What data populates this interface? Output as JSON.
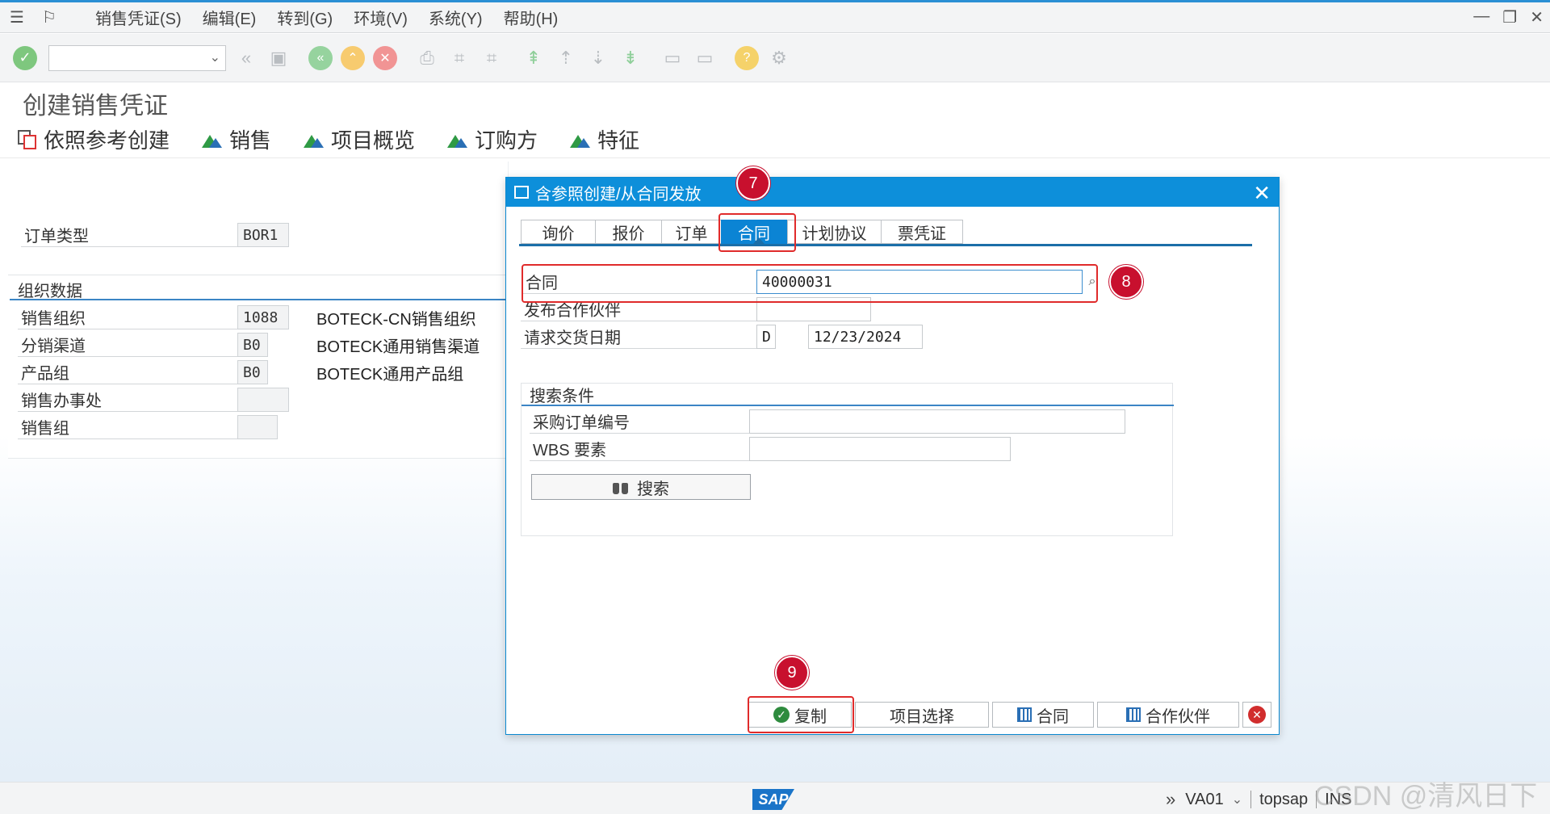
{
  "menubar": {
    "items": [
      "销售凭证(S)",
      "编辑(E)",
      "转到(G)",
      "环境(V)",
      "系统(Y)",
      "帮助(H)"
    ]
  },
  "toolbar": {
    "command_value": "",
    "icons": [
      "ok-icon",
      "back-icon",
      "save-icon",
      "nav-back-icon",
      "exit-icon",
      "cancel-icon",
      "print-icon",
      "find-icon",
      "find-next-icon",
      "first-page-icon",
      "prev-page-icon",
      "next-page-icon",
      "last-page-icon",
      "new-session-icon",
      "shortcut-icon",
      "help-icon",
      "settings-icon"
    ]
  },
  "page": {
    "title": "创建销售凭证"
  },
  "app_toolbar": {
    "ref_create": "依照参考创建",
    "sales": "销售",
    "item_overview": "项目概览",
    "sold_to": "订购方",
    "characteristics": "特征"
  },
  "header": {
    "order_type_label": "订单类型",
    "order_type_value": "BOR1"
  },
  "org": {
    "title": "组织数据",
    "rows": [
      {
        "label": "销售组织",
        "value": "1088",
        "desc": "BOTECK-CN销售组织"
      },
      {
        "label": "分销渠道",
        "value": "B0",
        "desc": "BOTECK通用销售渠道"
      },
      {
        "label": "产品组",
        "value": "B0",
        "desc": "BOTECK通用产品组"
      },
      {
        "label": "销售办事处",
        "value": "",
        "desc": ""
      },
      {
        "label": "销售组",
        "value": "",
        "desc": ""
      }
    ]
  },
  "dialog": {
    "title": "含参照创建/从合同发放",
    "tabs": [
      "询价",
      "报价",
      "订单",
      "合同",
      "计划协议",
      "票凭证"
    ],
    "active_tab": "合同",
    "contract_label": "合同",
    "contract_value": "40000031",
    "partner_label": "发布合作伙伴",
    "partner_value": "",
    "delivery_label": "请求交货日期",
    "delivery_type": "D",
    "delivery_date": "12/23/2024",
    "search_title": "搜索条件",
    "po_label": "采购订单编号",
    "po_value": "",
    "wbs_label": "WBS 要素",
    "wbs_value": "",
    "search_button": "搜索",
    "footer": {
      "copy": "复制",
      "item_select": "项目选择",
      "contract": "合同",
      "partner": "合作伙伴"
    }
  },
  "annotations": [
    "7",
    "8",
    "9"
  ],
  "status": {
    "sap_logo": "SAP",
    "transaction": "VA01",
    "server": "topsap",
    "mode": "INS"
  },
  "watermark": "CSDN @清风日下"
}
